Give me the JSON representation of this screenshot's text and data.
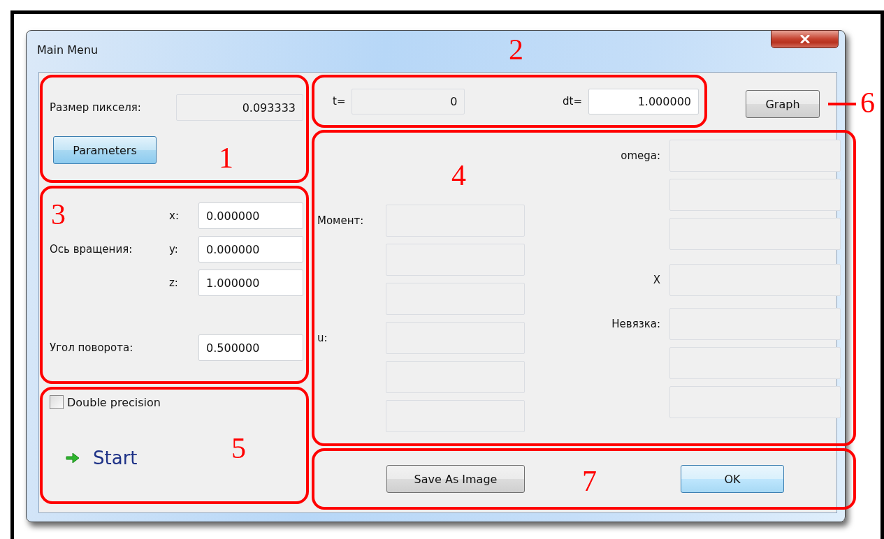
{
  "window": {
    "title": "Main Menu"
  },
  "section_1": {
    "annotation": "1",
    "pixel_size": {
      "label": "Размер пикселя:",
      "value": "0.093333",
      "readonly": true
    },
    "parameters_button": "Parameters"
  },
  "section_2": {
    "annotation": "2",
    "fields": [
      {
        "label": "t=",
        "value": "0",
        "readonly": true
      },
      {
        "label": "dt=",
        "value": "1.000000",
        "readonly": false
      }
    ]
  },
  "section_6": {
    "annotation": "6",
    "graph_button": "Graph"
  },
  "section_3": {
    "annotation": "3",
    "axis_label": "Ось вращения:",
    "components": [
      {
        "label": "x:",
        "value": "0.000000",
        "readonly": false
      },
      {
        "label": "y:",
        "value": "0.000000",
        "readonly": false
      },
      {
        "label": "z:",
        "value": "1.000000",
        "readonly": false
      }
    ],
    "angle": {
      "label": "Угол поворота:",
      "value": "0.500000",
      "readonly": false
    }
  },
  "section_4": {
    "annotation": "4",
    "columns": [
      [
        {
          "label": "Момент:",
          "fields": [
            {
              "readonly": true
            },
            {
              "readonly": true
            },
            {
              "readonly": true
            }
          ]
        },
        {
          "label": "u:",
          "fields": [
            {
              "readonly": true
            },
            {
              "readonly": true
            },
            {
              "readonly": true
            }
          ]
        }
      ],
      [
        {
          "label": "omega:",
          "fields": [
            {
              "readonly": true
            },
            {
              "readonly": true
            },
            {
              "readonly": true
            }
          ]
        },
        {
          "label": "X",
          "fields": [
            {
              "readonly": true
            }
          ]
        },
        {
          "label": "Невязка:",
          "fields": [
            {
              "readonly": true
            },
            {
              "readonly": true
            },
            {
              "readonly": true
            }
          ]
        }
      ]
    ]
  },
  "section_5": {
    "annotation": "5",
    "double_precision": {
      "label": "Double precision",
      "checked": false
    },
    "start_link": "Start"
  },
  "section_7": {
    "annotation": "7",
    "buttons": [
      {
        "label": "Save As Image",
        "kind": "plain"
      },
      {
        "label": "OK",
        "kind": "default"
      }
    ]
  }
}
